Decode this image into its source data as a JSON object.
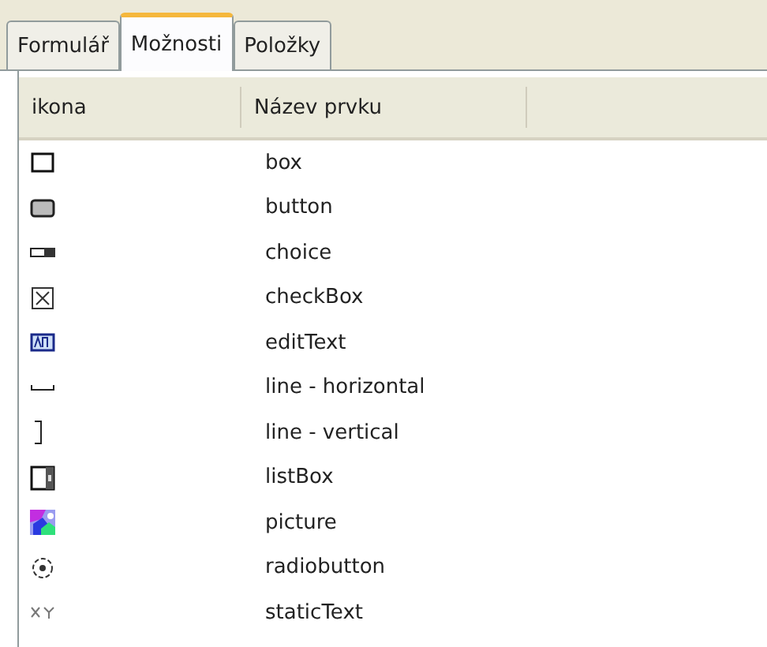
{
  "tabs": [
    {
      "label": "Formulář",
      "selected": false
    },
    {
      "label": "Možnosti",
      "selected": true
    },
    {
      "label": "Položky",
      "selected": false
    }
  ],
  "table": {
    "columns": [
      "ikona",
      "Název prvku"
    ],
    "rows": [
      {
        "kind": "box",
        "name": "box"
      },
      {
        "kind": "button",
        "name": "button"
      },
      {
        "kind": "choice",
        "name": "choice"
      },
      {
        "kind": "checkbox",
        "name": "checkBox"
      },
      {
        "kind": "edittext",
        "name": "editText"
      },
      {
        "kind": "hline",
        "name": "line - horizontal"
      },
      {
        "kind": "vline",
        "name": "line - vertical"
      },
      {
        "kind": "listbox",
        "name": "listBox"
      },
      {
        "kind": "picture",
        "name": "picture"
      },
      {
        "kind": "radio",
        "name": "radiobutton"
      },
      {
        "kind": "statictext",
        "name": "staticText"
      }
    ]
  }
}
